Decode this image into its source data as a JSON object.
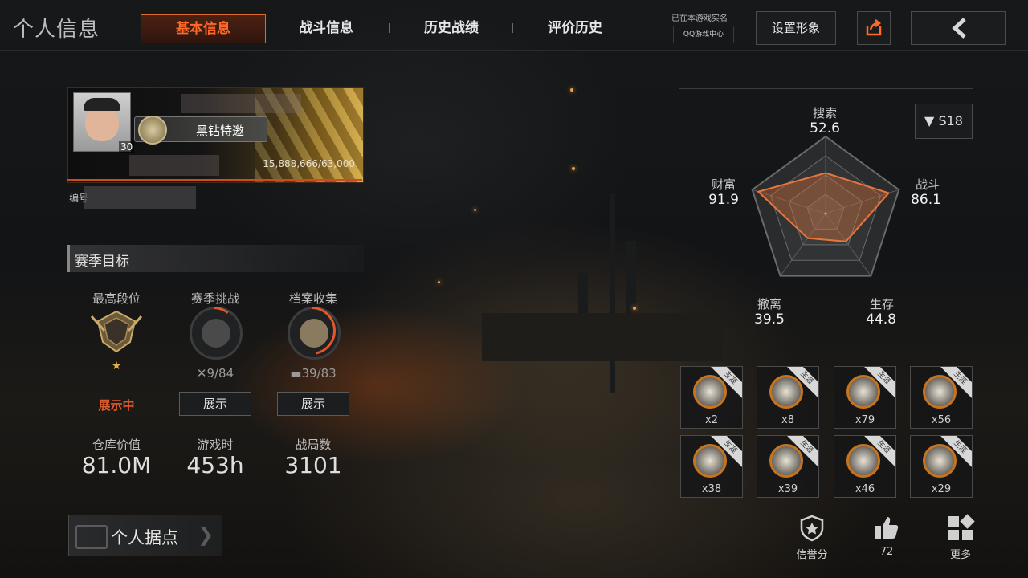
{
  "header": {
    "title": "个人信息",
    "tabs": [
      {
        "label": "基本信息",
        "active": true
      },
      {
        "label": "战斗信息",
        "active": false
      },
      {
        "label": "历史战绩",
        "active": false
      },
      {
        "label": "评价历史",
        "active": false
      }
    ],
    "realname_label": "已在本游戏实名",
    "realname_badge": "QQ游戏中心",
    "set_image_button": "设置形象",
    "share_icon": "share-icon",
    "back_icon": "chevron-left-icon",
    "accent_color": "#e06a30"
  },
  "profile": {
    "level": "30",
    "rank_title": "黑钻特邀",
    "exp": "15,888,666/63,000",
    "id_label": "编号"
  },
  "season_goals": {
    "title": "赛季目标",
    "items": [
      {
        "label": "最高段位",
        "status": "展示中"
      },
      {
        "label": "赛季挑战",
        "count": "9/84",
        "button": "展示",
        "progress": 0.107
      },
      {
        "label": "档案收集",
        "count": "39/83",
        "button": "展示",
        "progress": 0.47
      }
    ]
  },
  "stats": [
    {
      "label": "仓库价值",
      "value": "81.0M"
    },
    {
      "label": "游戏时",
      "value": "453h"
    },
    {
      "label": "战局数",
      "value": "3101"
    }
  ],
  "base_button": "个人据点",
  "season_select": "S18",
  "radar": {
    "axes": [
      {
        "label": "搜索",
        "value": "52.6",
        "score": 52.6
      },
      {
        "label": "战斗",
        "value": "86.1",
        "score": 86.1
      },
      {
        "label": "生存",
        "value": "44.8",
        "score": 44.8
      },
      {
        "label": "撤离",
        "value": "39.5",
        "score": 39.5
      },
      {
        "label": "财富",
        "value": "91.9",
        "score": 91.9
      }
    ],
    "max": 100,
    "fill_color": "#e8763a"
  },
  "badges": {
    "ribbon": "生涯",
    "items": [
      {
        "count": "x2",
        "icon": "vehicle-badge-icon"
      },
      {
        "count": "x8",
        "icon": "crate-badge-icon"
      },
      {
        "count": "x79",
        "icon": "bust-badge-icon"
      },
      {
        "count": "x56",
        "icon": "statue-badge-icon"
      },
      {
        "count": "x38",
        "icon": "teapot-badge-icon"
      },
      {
        "count": "x39",
        "icon": "vase-badge-icon"
      },
      {
        "count": "x46",
        "icon": "crown-badge-icon"
      },
      {
        "count": "x29",
        "icon": "lamp-badge-icon"
      }
    ]
  },
  "bottom": {
    "reputation": "信誉分",
    "likes": "72",
    "more": "更多"
  }
}
